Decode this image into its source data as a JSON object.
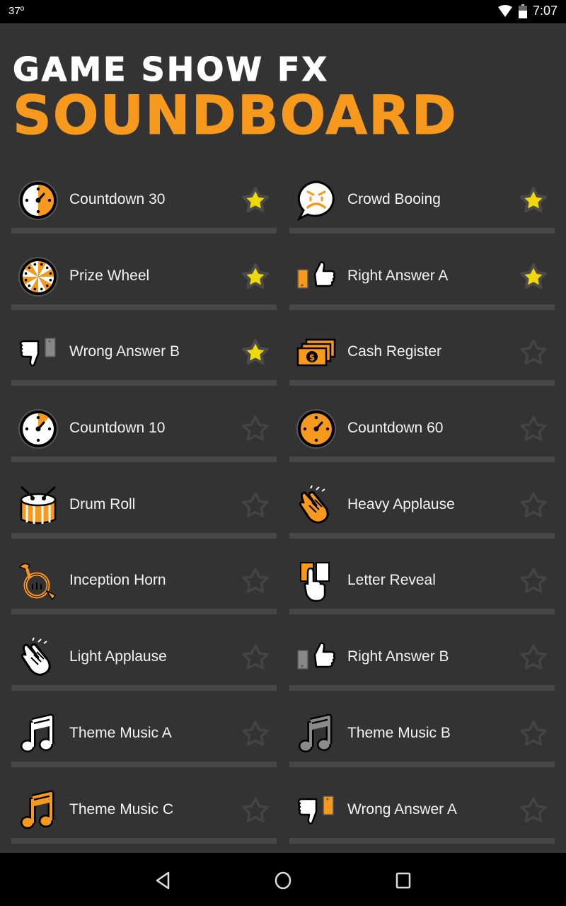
{
  "status_bar": {
    "temperature": "37º",
    "time": "7:07",
    "icons": [
      "wifi-icon",
      "battery-icon"
    ]
  },
  "header": {
    "title_line1": "GAME SHOW FX",
    "title_line2": "SOUNDBOARD"
  },
  "colors": {
    "background": "#333333",
    "separator": "#474747",
    "accent_orange": "#f7991c",
    "star_favorite": "#f0d90a",
    "star_outline": "#444444"
  },
  "sounds": [
    {
      "label": "Countdown 30",
      "icon": "clock-half-icon",
      "favorite": true
    },
    {
      "label": "Crowd Booing",
      "icon": "angry-speech-bubble-icon",
      "favorite": true
    },
    {
      "label": "Prize Wheel",
      "icon": "prize-wheel-icon",
      "favorite": true
    },
    {
      "label": "Right Answer A",
      "icon": "thumbs-up-orange-icon",
      "favorite": true
    },
    {
      "label": "Wrong Answer B",
      "icon": "thumbs-down-gray-icon",
      "favorite": true
    },
    {
      "label": "Cash Register",
      "icon": "cash-stack-icon",
      "favorite": false
    },
    {
      "label": "Countdown 10",
      "icon": "clock-sliver-icon",
      "favorite": false
    },
    {
      "label": "Countdown 60",
      "icon": "clock-full-icon",
      "favorite": false
    },
    {
      "label": "Drum Roll",
      "icon": "drum-icon",
      "favorite": false
    },
    {
      "label": "Heavy Applause",
      "icon": "clapping-hands-orange-icon",
      "favorite": false
    },
    {
      "label": "Inception Horn",
      "icon": "french-horn-icon",
      "favorite": false
    },
    {
      "label": "Letter Reveal",
      "icon": "letter-reveal-icon",
      "favorite": false
    },
    {
      "label": "Light Applause",
      "icon": "clapping-hands-white-icon",
      "favorite": false
    },
    {
      "label": "Right Answer B",
      "icon": "thumbs-up-gray-icon",
      "favorite": false
    },
    {
      "label": "Theme Music A",
      "icon": "music-note-white-icon",
      "favorite": false
    },
    {
      "label": "Theme Music B",
      "icon": "music-note-gray-icon",
      "favorite": false
    },
    {
      "label": "Theme Music C",
      "icon": "music-note-orange-icon",
      "favorite": false
    },
    {
      "label": "Wrong Answer A",
      "icon": "thumbs-down-orange-icon",
      "favorite": false
    }
  ],
  "nav_bar": {
    "buttons": [
      "back",
      "home",
      "recents"
    ]
  }
}
